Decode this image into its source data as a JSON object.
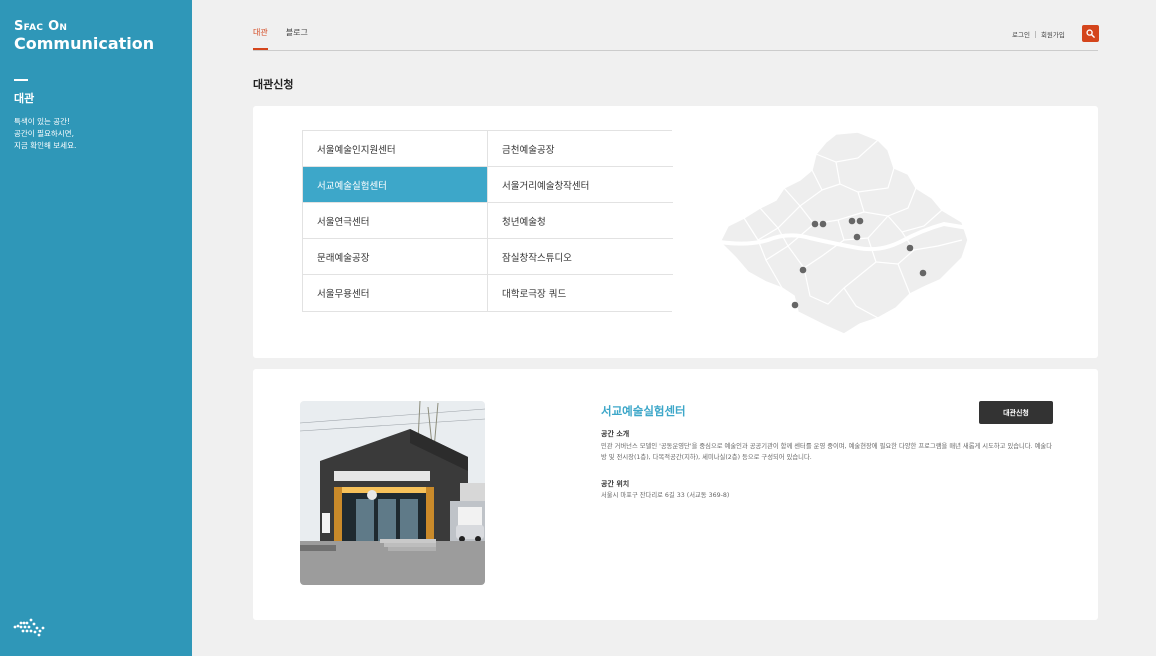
{
  "sidebar": {
    "brand_line1": "Sfac On",
    "brand_line2": "Communication",
    "section_title": "대관",
    "description": "특색이 있는 공간!\n공간이 필요하시면,\n지금 확인해 보세요.",
    "logo_text": "서울문화재단"
  },
  "header": {
    "tabs": [
      {
        "label": "대관",
        "active": true
      },
      {
        "label": "블로그",
        "active": false
      }
    ],
    "login_label": "로그인",
    "signup_label": "회원가입",
    "search_icon": "search-icon"
  },
  "page": {
    "title": "대관신청"
  },
  "venues": {
    "items": [
      {
        "label": "서울예술인지원센터",
        "active": false
      },
      {
        "label": "금천예술공장",
        "active": false
      },
      {
        "label": "서교예술실험센터",
        "active": true
      },
      {
        "label": "서울거리예술창작센터",
        "active": false
      },
      {
        "label": "서울연극센터",
        "active": false
      },
      {
        "label": "청년예술청",
        "active": false
      },
      {
        "label": "문래예술공장",
        "active": false
      },
      {
        "label": "잠실창작스튜디오",
        "active": false
      },
      {
        "label": "서울무용센터",
        "active": false
      },
      {
        "label": "대학로극장 쿼드",
        "active": false
      }
    ]
  },
  "detail": {
    "name": "서교예술실험센터",
    "apply_label": "대관신청",
    "intro_label": "공간 소개",
    "intro_text": "민관 거버넌스 모델인 '공동운영단'을 중심으로 예술인과 공공기관이 함께 센터를 운영 중이며, 예술현장에 필요한 다양한 프로그램을 매년 새롭게 시도하고 있습니다. 예술다방 및 전시장(1층), 다목적공간(지하), 세미나실(2층) 등으로 구성되어 있습니다.",
    "location_label": "공간 위치",
    "address": "서울시 마포구 잔다리로 6길 33 (서교동 369-8)"
  },
  "colors": {
    "sidebar": "#2f97b8",
    "accent_active": "#3da7c9",
    "nav_active": "#d4451c",
    "button_dark": "#333333"
  }
}
